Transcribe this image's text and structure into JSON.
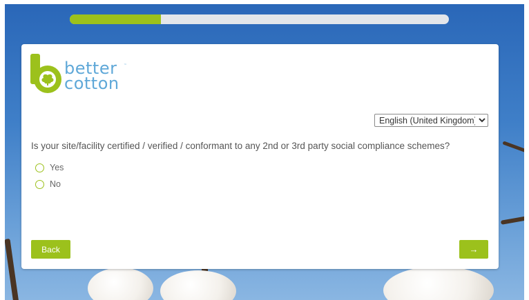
{
  "progress": {
    "fraction": 0.24
  },
  "logo": {
    "line1": "better",
    "line2": "cotton",
    "tm": "™"
  },
  "language": {
    "selected": "English (United Kingdom)",
    "options": [
      "English (United Kingdom)"
    ]
  },
  "question": {
    "text": "Is your site/facility certified / verified / conformant to any 2nd or 3rd party social compliance schemes?"
  },
  "answers": [
    {
      "label": "Yes"
    },
    {
      "label": "No"
    }
  ],
  "buttons": {
    "back_label": "Back",
    "next_label": "→"
  },
  "colors": {
    "accent": "#9cc11c",
    "logo_blue": "#5fa8d8",
    "track": "#e3e6ea"
  },
  "icons": {
    "logo_mark": "better-cotton-logo-icon"
  }
}
